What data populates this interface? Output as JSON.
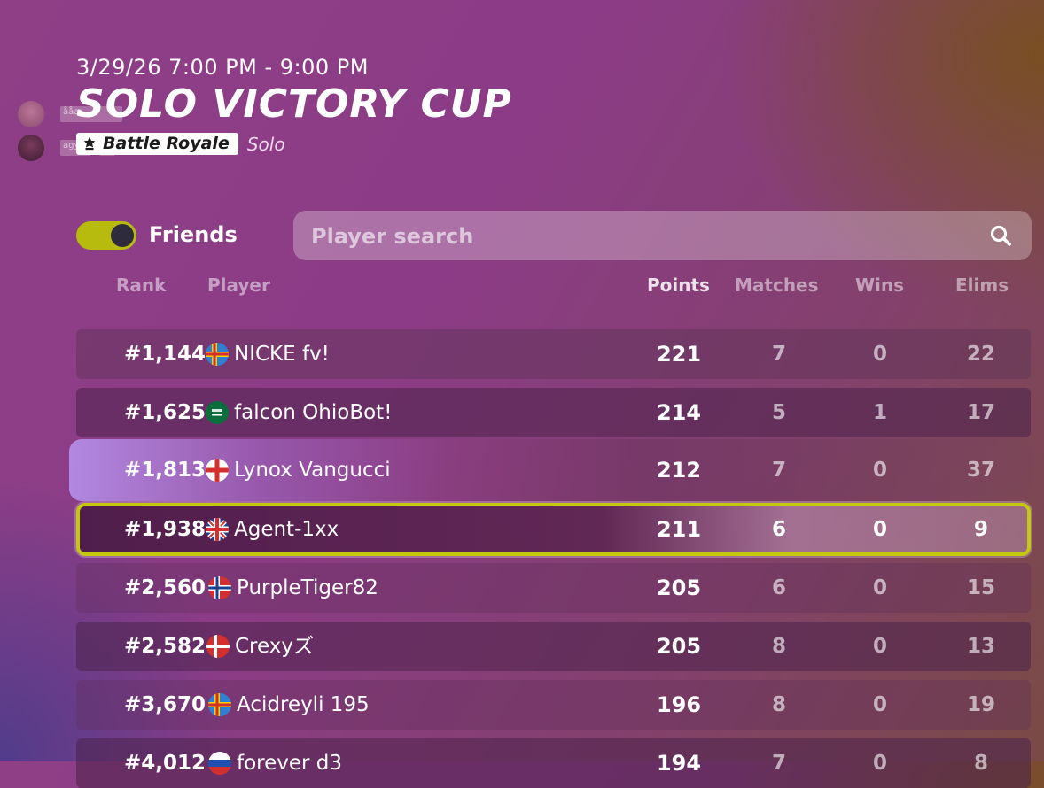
{
  "event": {
    "time_range": "3/29/26 7:00 PM - 9:00 PM",
    "title": "SOLO VICTORY CUP",
    "mode_badge": "Battle Royale",
    "mode_sub": "Solo"
  },
  "friend_tags": [
    "ååæ",
    "agy!"
  ],
  "controls": {
    "friends_toggle_label": "Friends",
    "friends_toggle_on": true,
    "search_placeholder": "Player search"
  },
  "columns": {
    "rank": "Rank",
    "player": "Player",
    "points": "Points",
    "matches": "Matches",
    "wins": "Wins",
    "elims": "Elims"
  },
  "rows": [
    {
      "rank": "#1,144",
      "flag": "aland",
      "player": "NICKE fv!",
      "points": "221",
      "matches": "7",
      "wins": "0",
      "elims": "22"
    },
    {
      "rank": "#1,625",
      "flag": "saudi-arabia",
      "player": "falcon OhioBot!",
      "points": "214",
      "matches": "5",
      "wins": "1",
      "elims": "17"
    },
    {
      "rank": "#1,813",
      "flag": "england",
      "player": "Lynox Vangucci",
      "points": "212",
      "matches": "7",
      "wins": "0",
      "elims": "37"
    },
    {
      "rank": "#1,938",
      "flag": "united-kingdom",
      "player": "Agent-1xx",
      "points": "211",
      "matches": "6",
      "wins": "0",
      "elims": "9"
    },
    {
      "rank": "#2,560",
      "flag": "norway",
      "player": "PurpleTiger82",
      "points": "205",
      "matches": "6",
      "wins": "0",
      "elims": "15"
    },
    {
      "rank": "#2,582",
      "flag": "denmark",
      "player": "Crexyズ",
      "points": "205",
      "matches": "8",
      "wins": "0",
      "elims": "13"
    },
    {
      "rank": "#3,670",
      "flag": "aland",
      "player": "Acidreyli 195",
      "points": "196",
      "matches": "8",
      "wins": "0",
      "elims": "19"
    },
    {
      "rank": "#4,012",
      "flag": "russia",
      "player": "forever d3",
      "points": "194",
      "matches": "7",
      "wins": "0",
      "elims": "8"
    }
  ],
  "colors": {
    "toggle_on": "#b6bb0e",
    "my_row_border": "#c4c90f"
  }
}
